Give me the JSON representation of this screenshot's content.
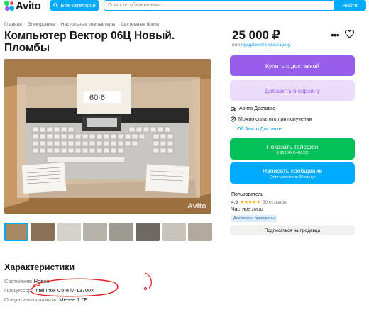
{
  "header": {
    "logo_text": "Avito",
    "categories_label": "Все категории",
    "search_placeholder": "Поиск по объявлениям",
    "search_button": "Найти"
  },
  "breadcrumb": [
    "Главная",
    "Электроника",
    "Настольные компьютеры",
    "Системные блоки"
  ],
  "listing": {
    "title": "Компьютер Вектор 06Ц Новый. Пломбы",
    "photo_watermark": "Avito",
    "thumbnails_count": 8
  },
  "price": {
    "value": "25 000 ₽",
    "prefix": "или",
    "suggest_link": "предложите свою цену"
  },
  "actions": {
    "buy_with_delivery": "Купить с доставкой",
    "add_to_cart": "Добавить в корзину",
    "show_phone": "Показать телефон",
    "phone_masked": "8 919 XXX-XX-XX",
    "write_message": "Написать сообщение",
    "reply_time": "Отвечает около 30 минут"
  },
  "delivery": {
    "avito_delivery": "Авито Доставка",
    "pay_on_receipt": "Можно оплатить при получении",
    "about_link": "Об Авито Доставке"
  },
  "seller": {
    "role": "Пользователь",
    "rating": "4,9",
    "stars": "★★★★★",
    "reviews": "30 отзывов",
    "type": "Частное лицо",
    "docs_badge": "Документы проверены",
    "subscribe": "Подписаться на продавца"
  },
  "characteristics": {
    "heading": "Характеристики",
    "rows": [
      {
        "key": "Состояние:",
        "value": "Новое"
      },
      {
        "key": "Процессор:",
        "value": "Intel Intel Core i7-13700K"
      },
      {
        "key": "Оперативная память:",
        "value": "Менее 1 ГБ"
      }
    ]
  },
  "colors": {
    "brand_blue": "#00aaff",
    "purple": "#965eeb",
    "green": "#04c058",
    "annotation_red": "#e02020"
  }
}
